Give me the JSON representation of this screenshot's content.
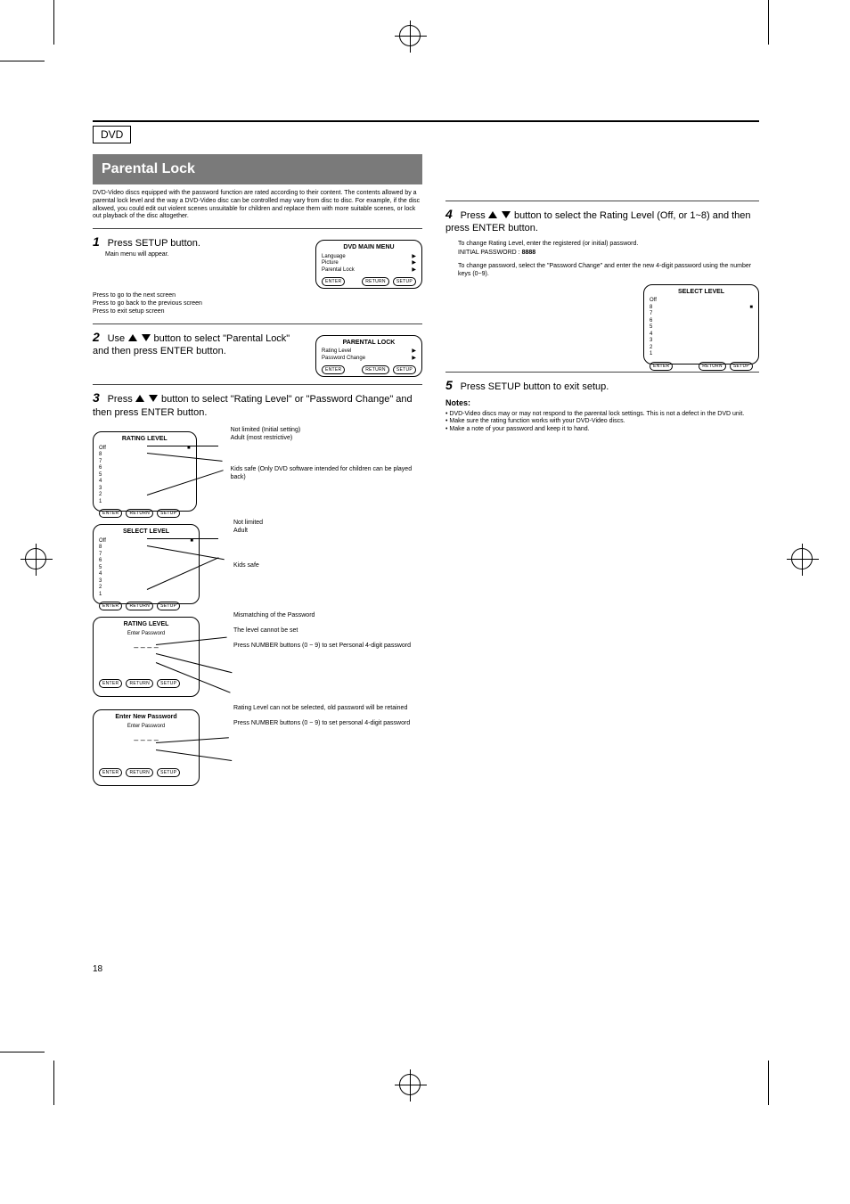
{
  "page_number": "18",
  "page_label": "DVD",
  "section_title": "Parental Lock",
  "intro": "DVD-Video discs equipped with the password function are rated according to their content. The contents allowed by a parental lock level and the way a DVD-Video disc can be controlled may vary from disc to disc. For example, if the disc allowed, you could edit out violent scenes unsuitable for children and replace them with more suitable scenes, or lock out playback of the disc altogether.",
  "step1": {
    "line": "Press SETUP button.",
    "sub": "Main menu will appear.",
    "screen_title": "DVD MAIN MENU",
    "rows": [
      [
        "Language",
        ""
      ],
      [
        "Picture",
        ""
      ],
      [
        "Parental Lock",
        ""
      ]
    ],
    "btns": [
      "ENTER",
      "RETURN",
      "SETUP"
    ],
    "btn_hint_enter": "Press to go to the next screen",
    "btn_hint_return": "Press to go back to the previous screen",
    "btn_hint_setup": "Press to exit setup screen"
  },
  "step2": {
    "line_pre": "Use",
    "line_post": "button to select \"Parental Lock\" and then press ENTER button.",
    "screen_title": "PARENTAL LOCK",
    "rows": [
      [
        "Rating Level",
        ""
      ],
      [
        "Password Change",
        ""
      ]
    ],
    "btns": [
      "ENTER",
      "RETURN",
      "SETUP"
    ]
  },
  "step3": {
    "line_pre": "Press",
    "line_post": "button to select \"Rating Level\" or \"Password Change\" and then press ENTER button."
  },
  "rating_screen": {
    "title": "RATING LEVEL",
    "rows": [
      [
        "Off",
        "■"
      ],
      [
        "8",
        ""
      ],
      [
        "7",
        ""
      ],
      [
        "6",
        ""
      ],
      [
        "5",
        ""
      ],
      [
        "4",
        ""
      ],
      [
        "3",
        ""
      ],
      [
        "2",
        ""
      ],
      [
        "1",
        ""
      ]
    ],
    "btns": [
      "ENTER",
      "RETURN",
      "SETUP"
    ],
    "hints": [
      "Not limited (Initial setting)",
      "Adult (most restrictive)",
      "",
      "Kids safe (Only DVD software intended for children can be played back)"
    ]
  },
  "select_level": {
    "title": "SELECT LEVEL",
    "rows": [
      [
        "Off",
        "■"
      ],
      [
        "8",
        ""
      ],
      [
        "7",
        ""
      ],
      [
        "6",
        ""
      ],
      [
        "5",
        ""
      ],
      [
        "4",
        ""
      ],
      [
        "3",
        ""
      ],
      [
        "2",
        ""
      ],
      [
        "1",
        ""
      ]
    ],
    "btns": [
      "ENTER",
      "RETURN",
      "SETUP"
    ],
    "hints": [
      "Not limited",
      "Adult",
      "",
      "",
      "Kids safe"
    ]
  },
  "password_entry": {
    "title": "RATING LEVEL",
    "prompt": "Enter Password",
    "mask": "– – – –",
    "btns": [
      "ENTER",
      "RETURN",
      "SETUP"
    ],
    "hints": [
      "Mismatching of the Password",
      "",
      "",
      "The level cannot be set",
      "",
      "Press NUMBER buttons (0 ~ 9) to set Personal 4-digit password"
    ]
  },
  "password_change": {
    "title": "Enter New Password",
    "prompt": "Enter Password",
    "mask": "– – – –",
    "btns": [
      "ENTER",
      "RETURN",
      "SETUP"
    ],
    "hints": [
      "Rating Level can not be selected, old password will be retained",
      "Press NUMBER buttons (0 ~ 9) to set personal 4-digit password"
    ]
  },
  "step4": {
    "line_pre": "Press",
    "line_post": "button to select the Rating Level (Off, or 1~8) and then press ENTER button.",
    "sub1": "To change Rating Level, enter the registered (or initial) password.",
    "initial_pw_label": "INITIAL PASSWORD : ",
    "initial_pw_value": "8888",
    "to_change": "To change password, select the \"Password Change\" and enter the new 4-digit password using the number keys (0~9).",
    "screen_title": "SELECT LEVEL",
    "rows": [
      [
        "Off",
        ""
      ],
      [
        "8",
        "■"
      ],
      [
        "7",
        ""
      ],
      [
        "6",
        ""
      ],
      [
        "5",
        ""
      ],
      [
        "4",
        ""
      ],
      [
        "3",
        ""
      ],
      [
        "2",
        ""
      ],
      [
        "1",
        ""
      ]
    ],
    "btns": [
      "ENTER",
      "RETURN",
      "SETUP"
    ]
  },
  "step5": {
    "line": "Press SETUP button to exit setup.",
    "notes_title": "Notes:",
    "notes": [
      "DVD-Video discs may or may not respond to the parental lock settings. This is not a defect in the DVD unit.",
      "Make sure the rating function works with your DVD-Video discs.",
      "Make a note of your password and keep it to hand."
    ]
  }
}
